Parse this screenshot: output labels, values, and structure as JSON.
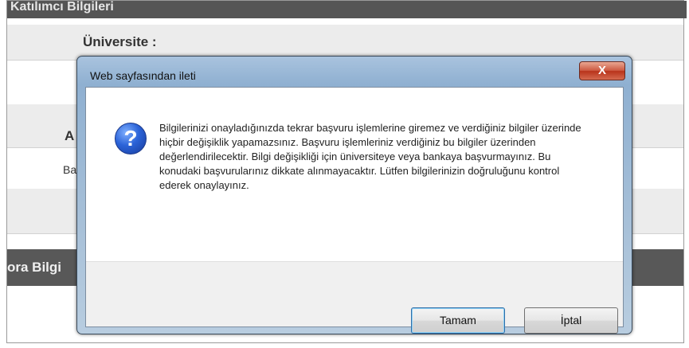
{
  "background": {
    "section1_header": "Katılımcı Bilgileri",
    "university_label": "Üniversite :",
    "row_label_a": "A",
    "row_label_bas": "Baş",
    "section2_header": "ora Bilgi"
  },
  "dialog": {
    "title": "Web sayfasından ileti",
    "close_glyph": "X",
    "icon_glyph": "?",
    "message": "Bilgilerinizi onayladığınızda tekrar başvuru işlemlerine giremez ve verdiğiniz bilgiler üzerinde hiçbir değişiklik yapamazsınız. Başvuru işlemleriniz verdiğiniz bu bilgiler üzerinden değerlendirilecektir. Bilgi değişikliği için üniversiteye veya bankaya başvurmayınız. Bu konudaki başvurularınız dikkate alınmayacaktır. Lütfen bilgilerinizin doğruluğunu kontrol ederek onaylayınız.",
    "ok_label": "Tamam",
    "cancel_label": "İptal"
  }
}
